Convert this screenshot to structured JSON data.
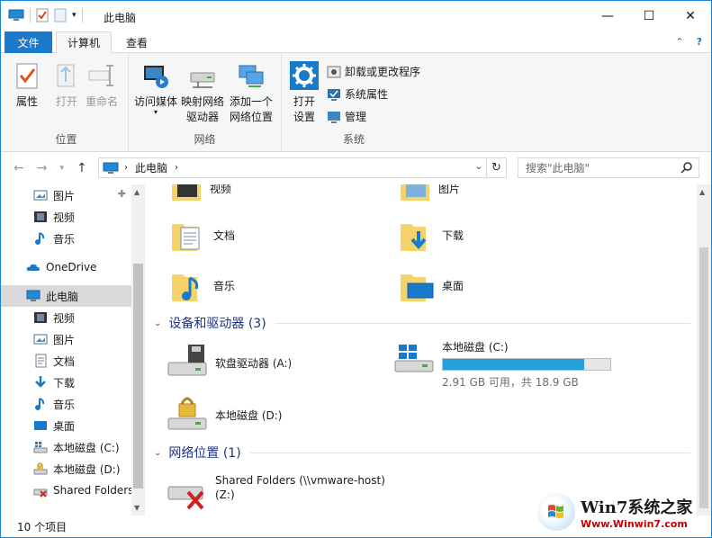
{
  "window": {
    "title": "此电脑"
  },
  "tabs": {
    "file": "文件",
    "computer": "计算机",
    "view": "查看"
  },
  "ribbon": {
    "location": {
      "label": "位置",
      "properties": "属性",
      "open": "打开",
      "rename": "重命名"
    },
    "network": {
      "label": "网络",
      "media": "访问媒体",
      "map_line1": "映射网络",
      "map_line2": "驱动器",
      "add_line1": "添加一个",
      "add_line2": "网络位置"
    },
    "system": {
      "label": "系统",
      "settings_line1": "打开",
      "settings_line2": "设置",
      "uninstall": "卸载或更改程序",
      "sysprops": "系统属性",
      "manage": "管理"
    }
  },
  "address": {
    "crumb": "此电脑",
    "search_placeholder": "搜索\"此电脑\""
  },
  "nav": {
    "pictures": "图片",
    "videos": "视频",
    "music": "音乐",
    "onedrive": "OneDrive",
    "this_pc": "此电脑",
    "videos2": "视频",
    "pictures2": "图片",
    "documents": "文档",
    "downloads": "下载",
    "music2": "音乐",
    "desktop": "桌面",
    "disk_c": "本地磁盘 (C:)",
    "disk_d": "本地磁盘 (D:)",
    "shared": "Shared Folders"
  },
  "folders": {
    "videos": "视频",
    "pictures": "图片",
    "documents": "文档",
    "downloads": "下载",
    "music": "音乐",
    "desktop": "桌面"
  },
  "devices": {
    "header": "设备和驱动器 (3)",
    "floppy": "软盘驱动器 (A:)",
    "disk_c": "本地磁盘 (C:)",
    "disk_c_free": "2.91 GB 可用，共 18.9 GB",
    "disk_c_used_fraction": 0.846,
    "disk_d": "本地磁盘 (D:)"
  },
  "network_loc": {
    "header": "网络位置 (1)",
    "shared_line1": "Shared Folders (\\\\vmware-host)",
    "shared_line2": "(Z:)"
  },
  "status": {
    "count": "10 个项目"
  },
  "watermark": {
    "title": "Win7系统之家",
    "url": "Www.Winwin7.com"
  }
}
